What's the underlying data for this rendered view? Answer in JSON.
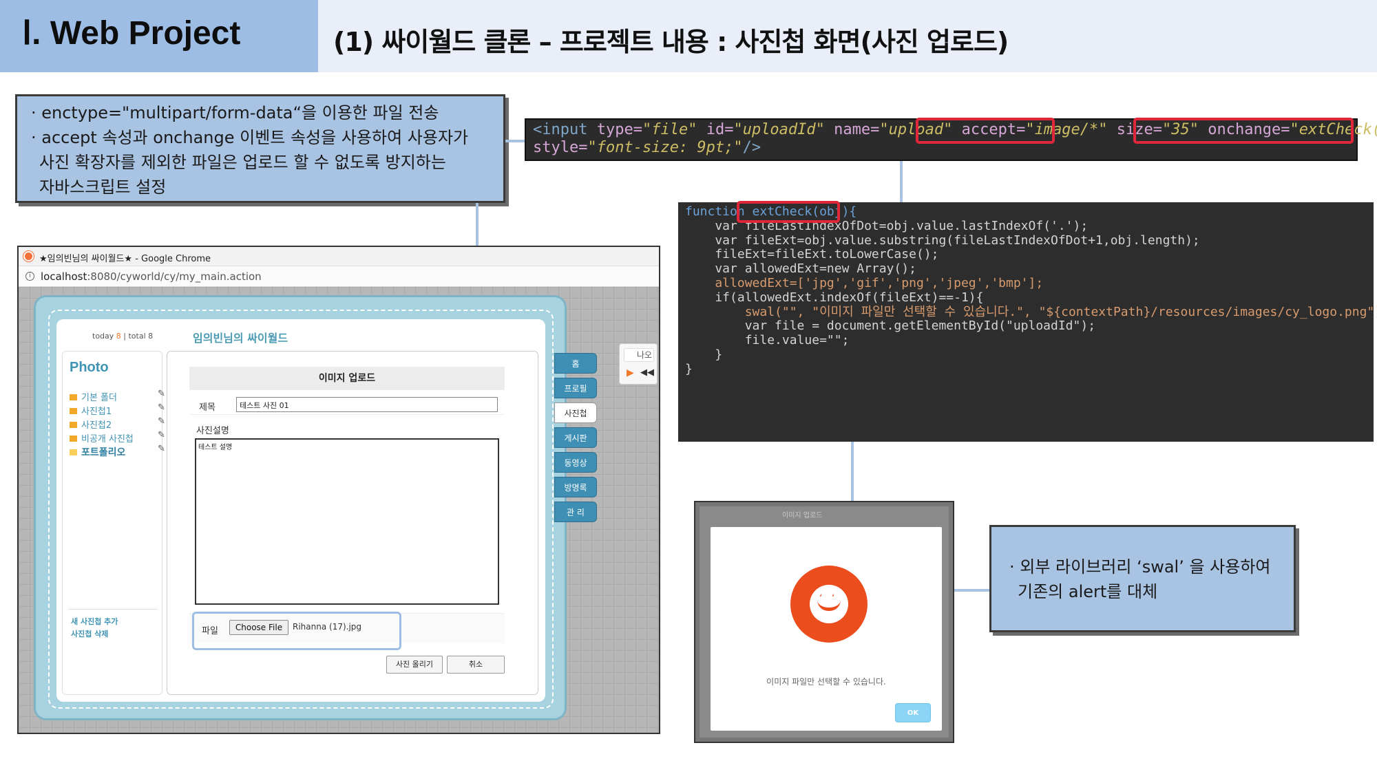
{
  "header": {
    "section_title": "Ⅰ. Web Project",
    "slide_title": "(1) 싸이월드 클론 – 프로젝트 내용 : 사진첩 화면(사진 업로드)"
  },
  "note_upload": {
    "lines": [
      "· enctype=\"multipart/form-data“을 이용한 파일 전송",
      "· accept 속성과 onchange 이벤트 속성을 사용하여 사용자가",
      "  사진 확장자를 제외한 파일은 업로드 할 수 없도록 방지하는",
      "  자바스크립트 설정"
    ]
  },
  "note_swal": {
    "lines": [
      "· 외부 라이브러리 ‘swal’ 을 사용하여",
      "  기존의 alert를 대체"
    ]
  },
  "code_input": {
    "tag_open": "<input",
    "type_attr": "type=",
    "type_val": "\"file\"",
    "id_attr": "id=",
    "id_val": "\"uploadId\"",
    "name_attr": "name=",
    "name_val": "\"upload\"",
    "accept_attr": "accept=",
    "accept_val": "\"image/*\"",
    "size_attr": "size=",
    "size_val": "\"35\"",
    "onchange_attr": "onchange=",
    "onchange_val": "\"extCheck(this)\"",
    "style_attr": "style=",
    "style_val": "\"font-size: 9pt;\"",
    "tag_close": "/>"
  },
  "code_function": {
    "lines": [
      "function extCheck(obj){",
      "",
      "    var fileLastIndexOfDot=obj.value.lastIndexOf('.');",
      "    var fileExt=obj.value.substring(fileLastIndexOfDot+1,obj.length);",
      "    fileExt=fileExt.toLowerCase();",
      "",
      "    var allowedExt=new Array();",
      "    allowedExt=['jpg','gif','png','jpeg','bmp'];",
      "",
      "    if(allowedExt.indexOf(fileExt)==-1){",
      "        swal(\"\", \"이미지 파일만 선택할 수 있습니다.\", \"${contextPath}/resources/images/cy_logo.png\");",
      "",
      "        var file = document.getElementById(\"uploadId\");",
      "        file.value=\"\";",
      "    }",
      "}"
    ]
  },
  "browser": {
    "window_title": "★임의빈님의 싸이월드★ - Google Chrome",
    "url_host": "localhost",
    "url_rest": ":8080/cyworld/cy/my_main.action",
    "today_label": "today",
    "today_count": "8",
    "total_label": "| total 8",
    "homepage_name": "임의빈님의 싸이월드",
    "section_title": "Photo",
    "folders": [
      "기본 폴더",
      "사진첩1",
      "사진첩2",
      "비공개 사진첩",
      "포트폴리오"
    ],
    "left_links": [
      "새 사진첩 추가",
      "사진첩 삭제"
    ],
    "upload_heading": "이미지 업로드",
    "title_label": "제목",
    "title_value": "테스트 사진 01",
    "desc_label": "사진설명",
    "desc_value": "테스트 설명",
    "file_label": "파일",
    "file_button": "Choose File",
    "file_name": "Rihanna (17).jpg",
    "submit_button": "사진 올리기",
    "cancel_button": "취소",
    "tabs": [
      "홈",
      "프로필",
      "사진첩",
      "게시판",
      "동영상",
      "방명록",
      "관 리"
    ],
    "selected_tab": "사진첩",
    "player_label": "나오"
  },
  "swal": {
    "background_title": "이미지 업로드",
    "message": "이미지 파일만 선택할 수 있습니다.",
    "ok_button": "OK",
    "logo_color": "#ec4d1c"
  },
  "colors": {
    "accent_blue": "#9dbde4",
    "highlight_red": "#e0263a",
    "cy_tab_blue": "#3f8fb5"
  }
}
